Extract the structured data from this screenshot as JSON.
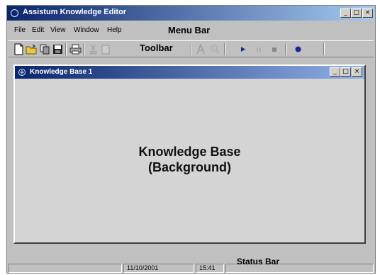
{
  "app": {
    "title": "Assistum Knowledge Editor",
    "caption_buttons": {
      "minimize": "_",
      "maximize": "□",
      "close": "×"
    }
  },
  "menu": {
    "items": [
      "File",
      "Edit",
      "View",
      "Window",
      "Help"
    ]
  },
  "callouts": {
    "menu_bar": "Menu Bar",
    "toolbar": "Toolbar",
    "knowledge_base_line1": "Knowledge Base",
    "knowledge_base_line2": "(Background)",
    "status_bar": "Status Bar"
  },
  "toolbar": {
    "icons": [
      "new-document-icon",
      "open-folder-icon",
      "copy-icon",
      "save-icon",
      "print-icon",
      "cut-icon",
      "paste-icon",
      "font-icon",
      "find-icon",
      "play-icon",
      "pause-icon",
      "stop-icon",
      "record-icon",
      "undo-icon"
    ]
  },
  "child_window": {
    "title": "Knowledge Base 1",
    "caption_buttons": {
      "minimize": "_",
      "maximize": "□",
      "close": "×"
    }
  },
  "statusbar": {
    "date": "11/10/2001",
    "time": "15:41"
  },
  "colors": {
    "titlebar_active": "#0a246a",
    "window_face": "#c0c0c0",
    "client_area": "#d4d4d4"
  }
}
